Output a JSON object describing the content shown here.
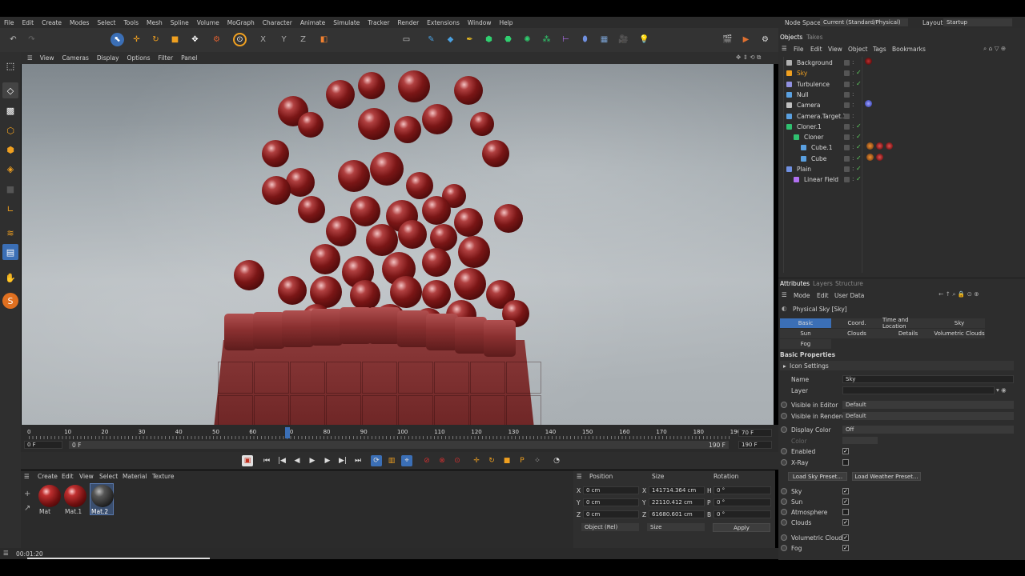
{
  "menu": [
    "File",
    "Edit",
    "Create",
    "Modes",
    "Select",
    "Tools",
    "Mesh",
    "Spline",
    "Volume",
    "MoGraph",
    "Character",
    "Animate",
    "Simulate",
    "Tracker",
    "Render",
    "Extensions",
    "Window",
    "Help"
  ],
  "topright": {
    "node_space_label": "Node Space:",
    "node_space_value": "Current (Standard/Physical)",
    "layout_label": "Layout:",
    "layout_value": "Startup"
  },
  "viewport_menu": [
    "View",
    "Cameras",
    "Display",
    "Options",
    "Filter",
    "Panel"
  ],
  "timeline": {
    "ticks": [
      "0",
      "10",
      "20",
      "30",
      "40",
      "50",
      "60",
      "70",
      "80",
      "90",
      "100",
      "110",
      "120",
      "130",
      "140",
      "150",
      "160",
      "170",
      "180",
      "190"
    ],
    "end_frame": "70 F",
    "start_field": "0 F",
    "offset_field": "0 F",
    "end_field": "190 F",
    "end_field2": "190 F",
    "current_frame": 70
  },
  "materials": {
    "menu": [
      "Create",
      "Edit",
      "View",
      "Select",
      "Material",
      "Texture"
    ],
    "items": [
      {
        "label": "Mat"
      },
      {
        "label": "Mat.1"
      },
      {
        "label": "Mat.2"
      }
    ]
  },
  "coords": {
    "headers": [
      "Position",
      "Size",
      "Rotation"
    ],
    "rows": [
      {
        "axis": "X",
        "pos": "0 cm",
        "size_axis": "X",
        "size": "141714.364 cm",
        "rot_axis": "H",
        "rot": "0 °"
      },
      {
        "axis": "Y",
        "pos": "0 cm",
        "size_axis": "Y",
        "size": "22110.412 cm",
        "rot_axis": "P",
        "rot": "0 °"
      },
      {
        "axis": "Z",
        "pos": "0 cm",
        "size_axis": "Z",
        "size": "61680.601 cm",
        "rot_axis": "B",
        "rot": "0 °"
      }
    ],
    "mode": "Object (Rel)",
    "size_mode": "Size",
    "apply": "Apply"
  },
  "status": {
    "time": "00:01:20"
  },
  "objects": {
    "tabs": [
      "Objects",
      "Takes"
    ],
    "menu": [
      "File",
      "Edit",
      "View",
      "Object",
      "Tags",
      "Bookmarks"
    ],
    "items": [
      {
        "name": "Background"
      },
      {
        "name": "Sky"
      },
      {
        "name": "Turbulence"
      },
      {
        "name": "Null"
      },
      {
        "name": "Camera"
      },
      {
        "name": "Camera.Target.1"
      },
      {
        "name": "Cloner.1"
      },
      {
        "name": "Cloner"
      },
      {
        "name": "Cube.1"
      },
      {
        "name": "Cube"
      },
      {
        "name": "Plain"
      },
      {
        "name": "Linear Field"
      }
    ]
  },
  "attributes": {
    "tabs": [
      "Attributes",
      "Layers",
      "Structure"
    ],
    "menu": [
      "Mode",
      "Edit",
      "User Data"
    ],
    "title": "Physical Sky [Sky]",
    "subtabs": [
      "Basic",
      "Coord.",
      "Time and Location",
      "Sky",
      "Sun",
      "Clouds",
      "Details",
      "Volumetric Clouds",
      "Fog"
    ],
    "section": "Basic Properties",
    "icon_settings": "Icon Settings",
    "name_label": "Name",
    "name_value": "Sky",
    "layer_label": "Layer",
    "vis_editor_label": "Visible in Editor",
    "vis_editor": "Default",
    "vis_render_label": "Visible in Renderer",
    "vis_render": "Default",
    "display_color_label": "Display Color",
    "display_color": "Off",
    "color_label": "Color",
    "enabled_label": "Enabled",
    "xray_label": "X-Ray",
    "load_sky": "Load Sky Preset...",
    "load_weather": "Load Weather Preset...",
    "toggles": [
      "Sky",
      "Sun",
      "Atmosphere",
      "Clouds",
      "Volumetric Clouds",
      "Fog"
    ]
  },
  "colors": {
    "accent": "#3b6fb6",
    "sphere": "#8a1c1c",
    "green": "#5fcf5f"
  }
}
